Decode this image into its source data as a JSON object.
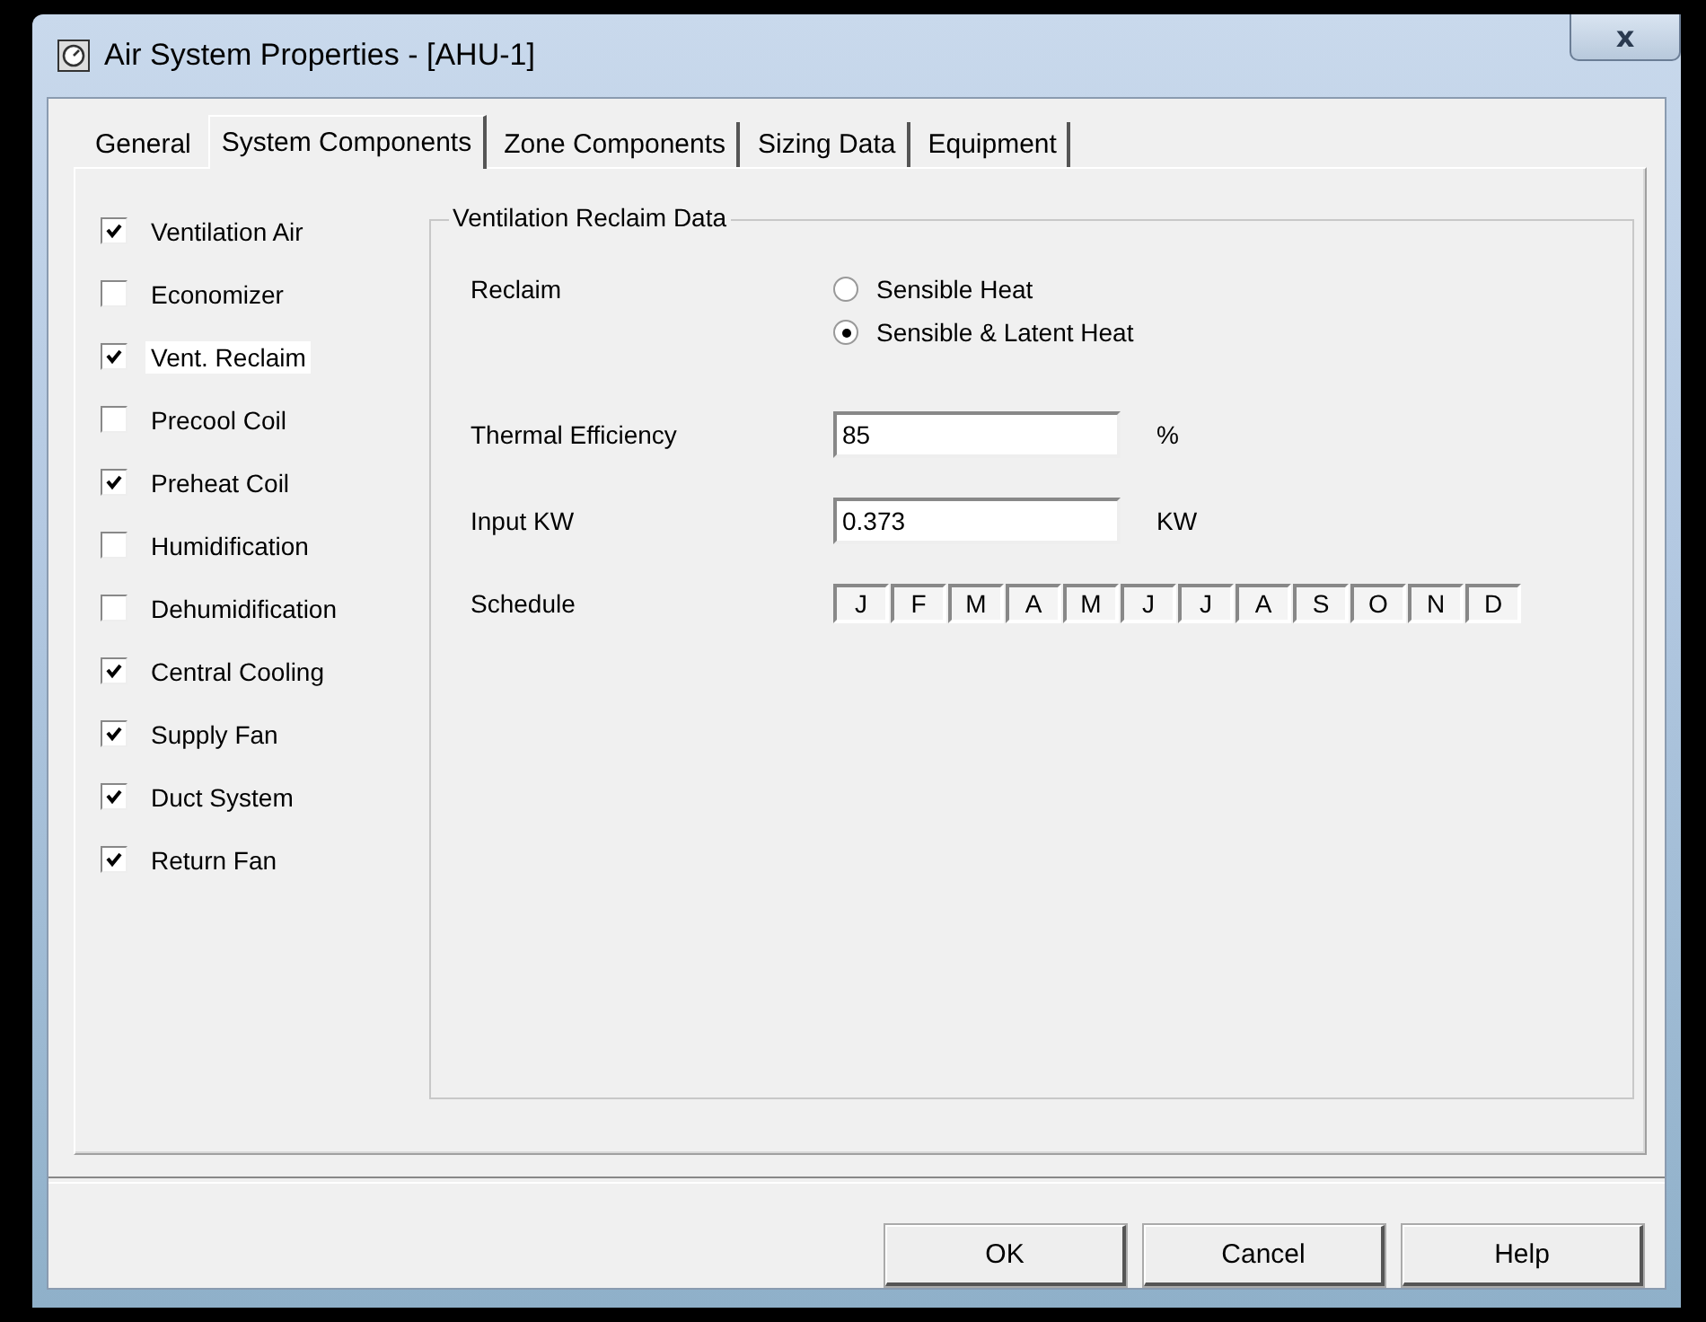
{
  "window": {
    "title": "Air System Properties - [AHU-1]",
    "close": "x"
  },
  "tabs": [
    {
      "label": "General",
      "selected": false
    },
    {
      "label": "System Components",
      "selected": true
    },
    {
      "label": "Zone Components",
      "selected": false
    },
    {
      "label": "Sizing Data",
      "selected": false
    },
    {
      "label": "Equipment",
      "selected": false
    }
  ],
  "components": [
    {
      "label": "Ventilation Air",
      "checked": true,
      "selected": false
    },
    {
      "label": "Economizer",
      "checked": false,
      "selected": false
    },
    {
      "label": "Vent. Reclaim",
      "checked": true,
      "selected": true
    },
    {
      "label": "Precool Coil",
      "checked": false,
      "selected": false
    },
    {
      "label": "Preheat Coil",
      "checked": true,
      "selected": false
    },
    {
      "label": "Humidification",
      "checked": false,
      "selected": false
    },
    {
      "label": "Dehumidification",
      "checked": false,
      "selected": false
    },
    {
      "label": "Central Cooling",
      "checked": true,
      "selected": false
    },
    {
      "label": "Supply Fan",
      "checked": true,
      "selected": false
    },
    {
      "label": "Duct System",
      "checked": true,
      "selected": false
    },
    {
      "label": "Return Fan",
      "checked": true,
      "selected": false
    }
  ],
  "group": {
    "title": "Ventilation Reclaim Data",
    "reclaim": {
      "label": "Reclaim",
      "options": [
        {
          "label": "Sensible Heat",
          "selected": false
        },
        {
          "label": "Sensible & Latent Heat",
          "selected": true
        }
      ]
    },
    "fields": [
      {
        "label": "Thermal Efficiency",
        "value": "85",
        "unit": "%"
      },
      {
        "label": "Input KW",
        "value": "0.373",
        "unit": "KW"
      }
    ],
    "schedule": {
      "label": "Schedule",
      "months": [
        "J",
        "F",
        "M",
        "A",
        "M",
        "J",
        "J",
        "A",
        "S",
        "O",
        "N",
        "D"
      ]
    }
  },
  "buttons": [
    "OK",
    "Cancel",
    "Help"
  ]
}
